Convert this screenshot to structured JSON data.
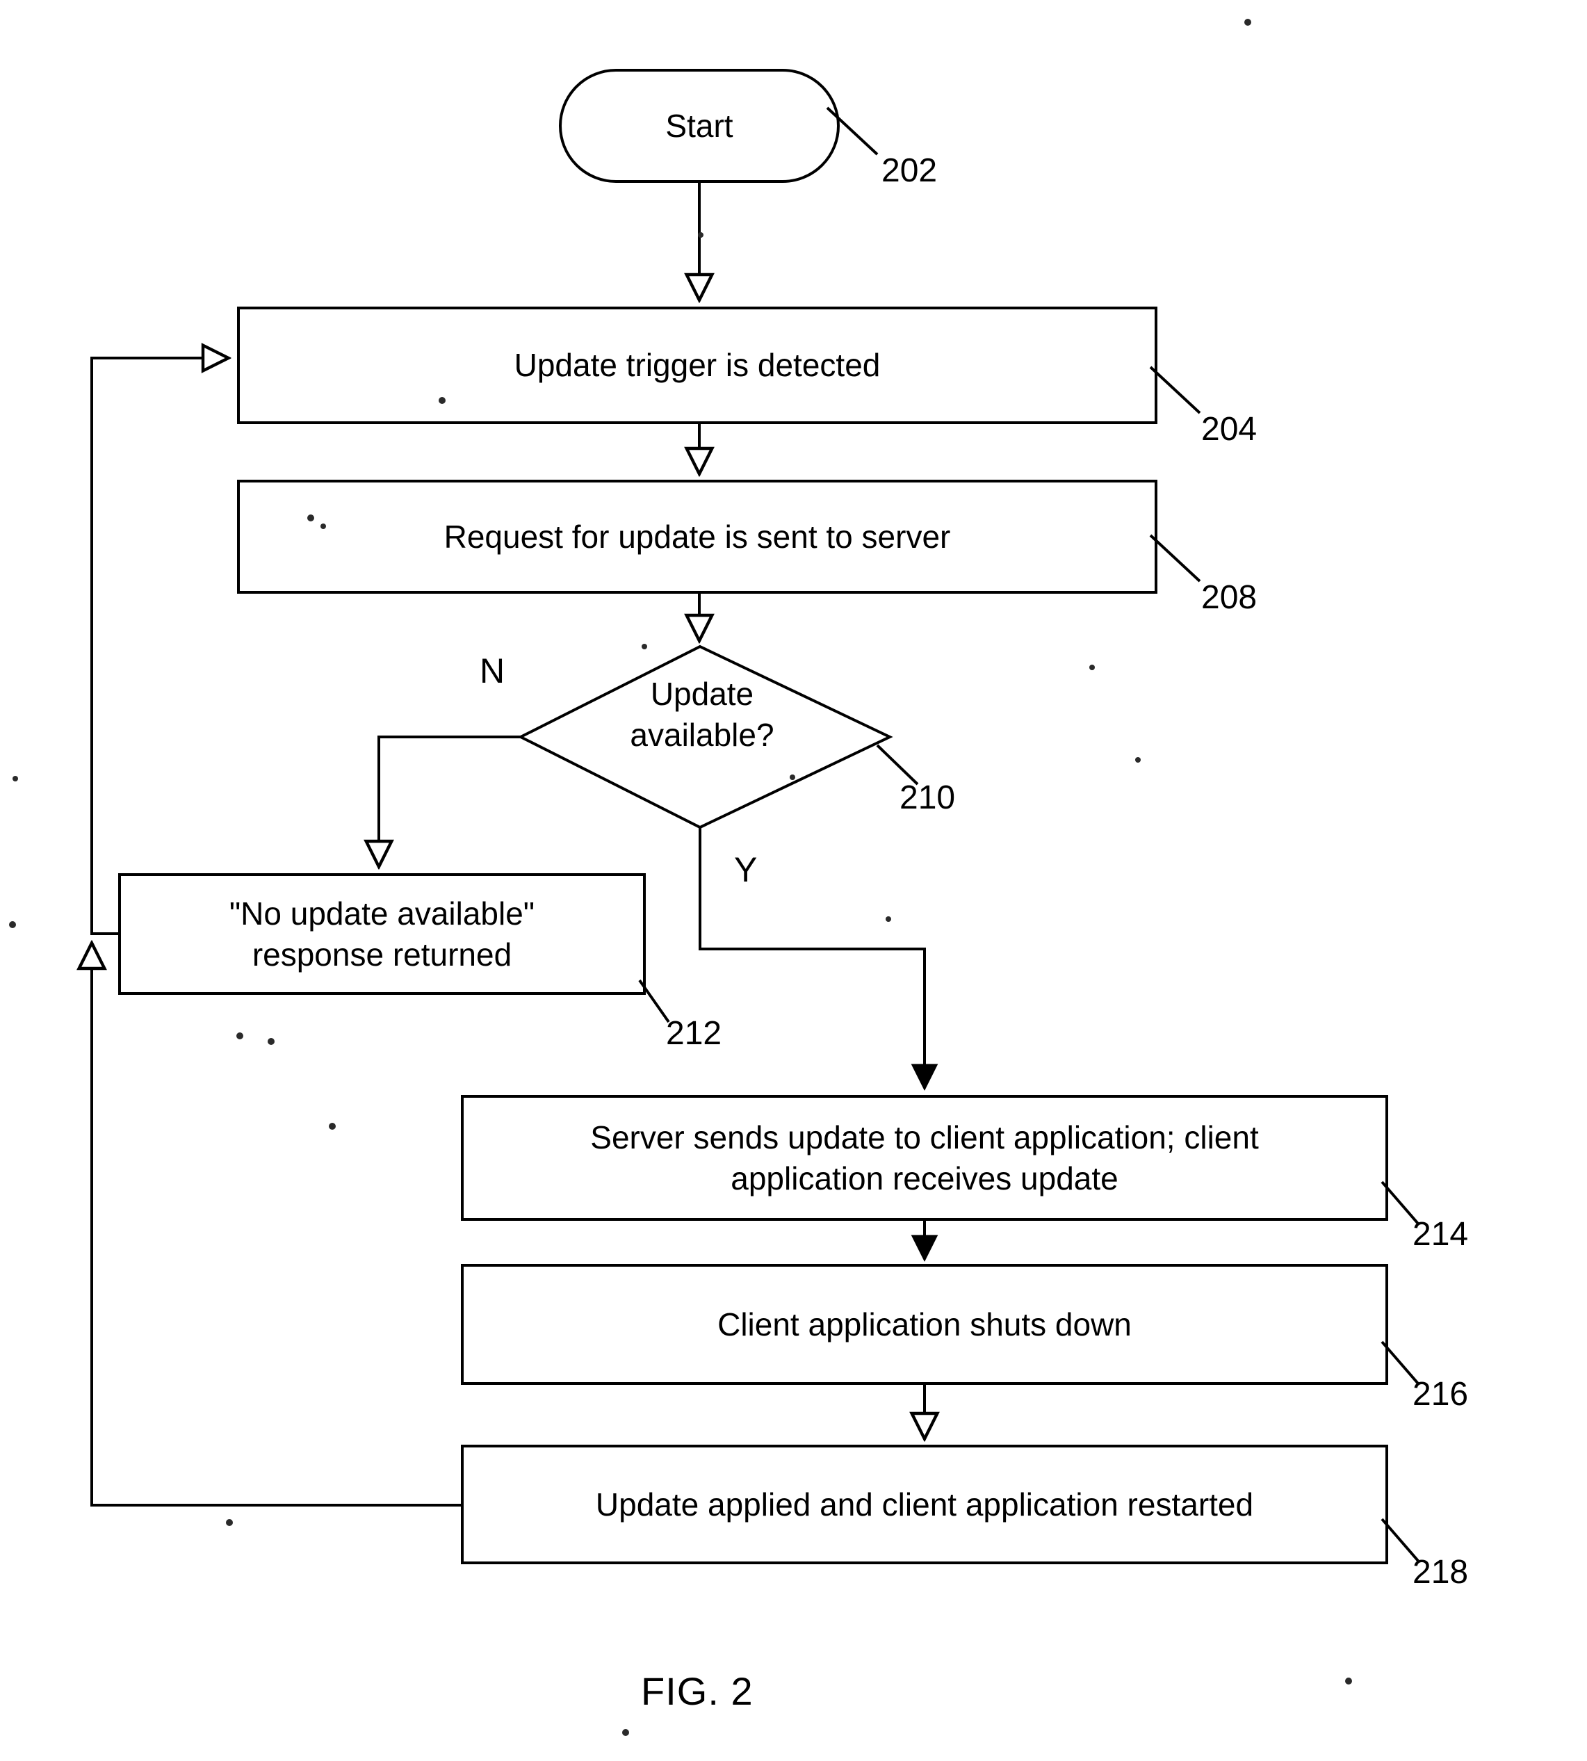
{
  "figure": {
    "caption": "FIG. 2",
    "title": "Client application update process flowchart"
  },
  "diagram_data": {
    "type": "flowchart",
    "nodes": [
      {
        "id": "start",
        "shape": "stadium",
        "text": "Start",
        "ref": "202"
      },
      {
        "id": "n204",
        "shape": "rect",
        "text": "Update trigger is detected",
        "ref": "204"
      },
      {
        "id": "n208",
        "shape": "rect",
        "text": "Request for update is sent to server",
        "ref": "208"
      },
      {
        "id": "n210",
        "shape": "diamond",
        "text": "Update\navailable?",
        "ref": "210"
      },
      {
        "id": "n212",
        "shape": "rect",
        "text": "\"No update available\"\nresponse returned",
        "ref": "212"
      },
      {
        "id": "n214",
        "shape": "rect",
        "text": "Server sends update to client application; client\napplication receives update",
        "ref": "214"
      },
      {
        "id": "n216",
        "shape": "rect",
        "text": "Client application shuts down",
        "ref": "216"
      },
      {
        "id": "n218",
        "shape": "rect",
        "text": "Update applied and client application restarted",
        "ref": "218"
      }
    ],
    "edges": [
      {
        "from": "start",
        "to": "n204",
        "label": ""
      },
      {
        "from": "n204",
        "to": "n208",
        "label": ""
      },
      {
        "from": "n208",
        "to": "n210",
        "label": ""
      },
      {
        "from": "n210",
        "to": "n212",
        "label": "N"
      },
      {
        "from": "n210",
        "to": "n214",
        "label": "Y"
      },
      {
        "from": "n214",
        "to": "n216",
        "label": ""
      },
      {
        "from": "n216",
        "to": "n218",
        "label": ""
      },
      {
        "from": "n212",
        "to": "n204",
        "label": ""
      },
      {
        "from": "n218",
        "to": "n204",
        "label": ""
      }
    ],
    "branch_labels": {
      "no": "N",
      "yes": "Y"
    }
  }
}
